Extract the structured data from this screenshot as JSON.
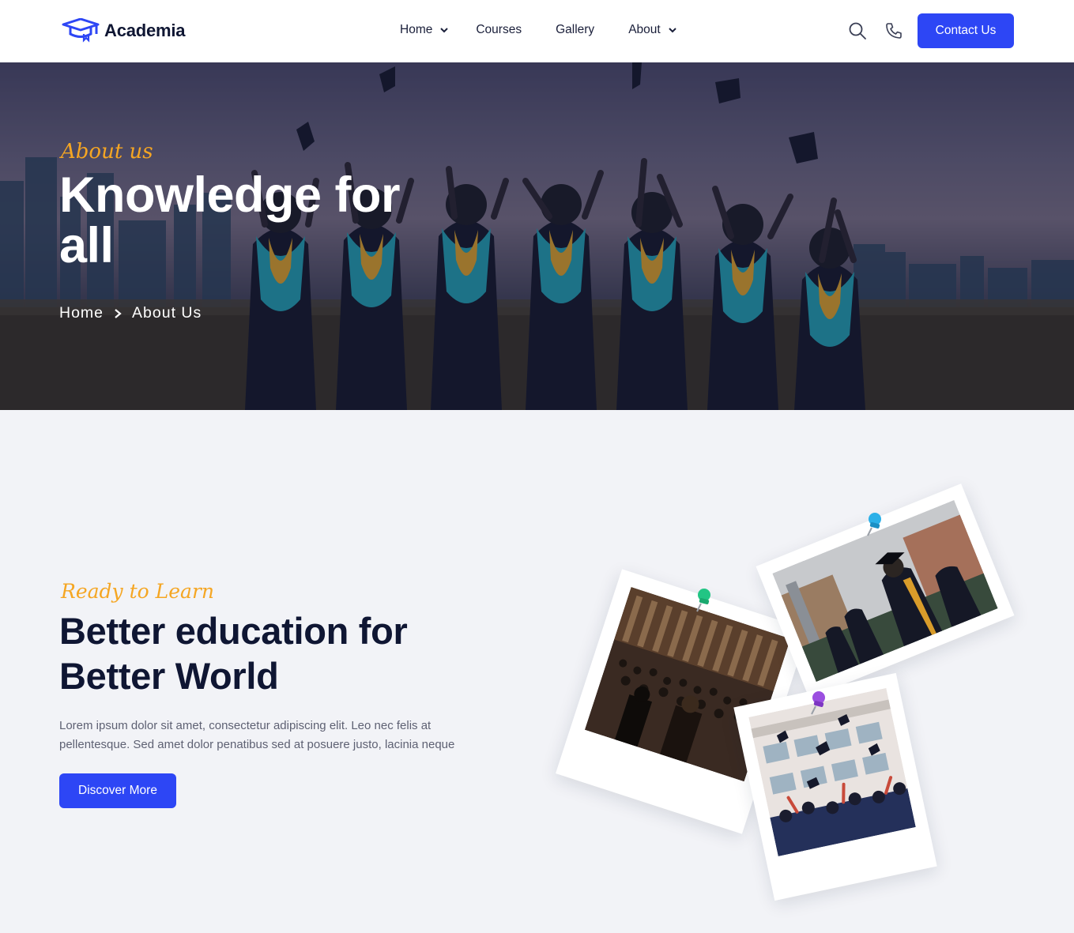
{
  "header": {
    "logo_text": "Academia",
    "logo_icon": "graduation-cap-icon",
    "nav": [
      {
        "label": "Home",
        "has_dropdown": true
      },
      {
        "label": "Courses",
        "has_dropdown": false
      },
      {
        "label": "Gallery",
        "has_dropdown": false
      },
      {
        "label": "About",
        "has_dropdown": true
      }
    ],
    "icons": [
      "search-icon",
      "phone-icon"
    ],
    "contact_label": "Contact Us"
  },
  "hero": {
    "subtitle": "About us",
    "title": "Knowledge for all",
    "breadcrumb": {
      "home": "Home",
      "current": "About Us"
    }
  },
  "about": {
    "subtitle": "Ready to Learn",
    "title": "Better education for Better World",
    "text": "Lorem ipsum dolor sit amet, consectetur adipiscing elit. Leo nec felis at pellentesque. Sed amet dolor penatibus sed at posuere justo, lacinia neque",
    "button_label": "Discover More"
  },
  "colors": {
    "primary": "#2d46f5",
    "accent": "#f5a623",
    "heading": "#0f1633",
    "section_bg": "#f2f3f7"
  },
  "gallery_pins": [
    "green",
    "blue",
    "purple"
  ]
}
